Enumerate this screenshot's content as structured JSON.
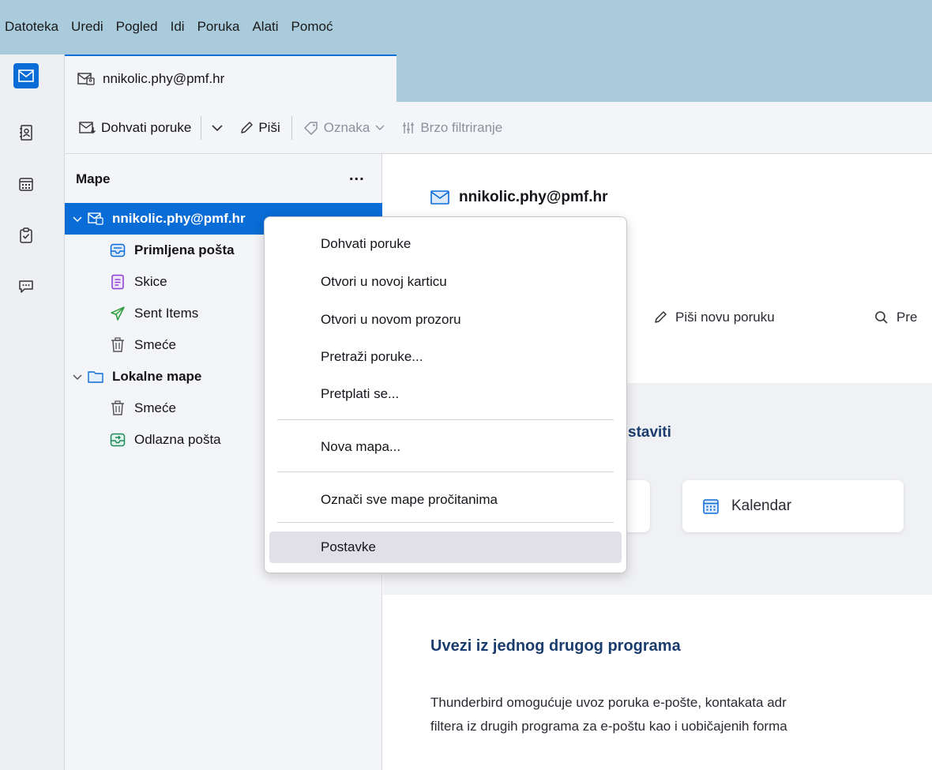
{
  "menubar": {
    "items": [
      "Datoteka",
      "Uredi",
      "Pogled",
      "Idi",
      "Poruka",
      "Alati",
      "Pomoć"
    ]
  },
  "tab": {
    "title": "nnikolic.phy@pmf.hr"
  },
  "toolbar": {
    "get_messages": "Dohvati poruke",
    "write": "Piši",
    "tag": "Oznaka",
    "quick_filter": "Brzo filtriranje"
  },
  "folder_pane": {
    "header": "Mape",
    "more": "...",
    "account": "nnikolic.phy@pmf.hr",
    "folders": [
      {
        "label": "Primljena pošta",
        "icon": "inbox-icon"
      },
      {
        "label": "Skice",
        "icon": "drafts-icon"
      },
      {
        "label": "Sent Items",
        "icon": "sent-icon"
      },
      {
        "label": "Smeće",
        "icon": "trash-icon"
      }
    ],
    "local": {
      "label": "Lokalne mape",
      "folders": [
        {
          "label": "Smeće",
          "icon": "trash-icon"
        },
        {
          "label": "Odlazna pošta",
          "icon": "outbox-icon"
        }
      ]
    }
  },
  "main": {
    "account_title": "nnikolic.phy@pmf.hr",
    "write_new": "Piši novu poruku",
    "search": "Pre",
    "setup_title": "staviti",
    "calendar_card": "Kalendar",
    "import_title": "Uvezi iz jednog drugog programa",
    "import_line1": "Thunderbird omogućuje uvoz poruka e-pošte, kontakata adr",
    "import_line2": "filtera iz drugih programa za e-poštu kao i uobičajenih forma"
  },
  "context_menu": {
    "items": [
      "Dohvati poruke",
      "Otvori u novoj karticu",
      "Otvori u novom prozoru",
      "Pretraži poruke...",
      "Pretplati se...",
      "Nova mapa...",
      "Označi sve mape pročitanima",
      "Postavke"
    ]
  },
  "colors": {
    "accent": "#0a6cd6",
    "menubar": "#a9cbdc",
    "heading": "#1a3c6e"
  }
}
